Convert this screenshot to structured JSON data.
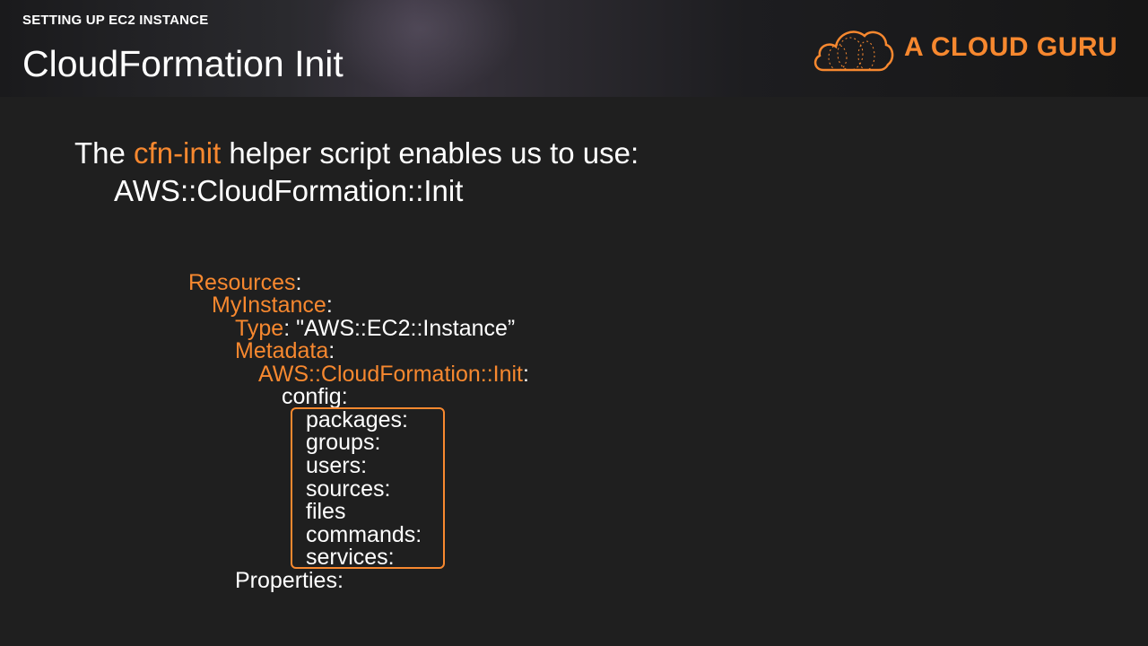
{
  "header": {
    "kicker": "SETTING UP EC2 INSTANCE",
    "title": "CloudFormation Init",
    "logo_text": "A CLOUD GURU",
    "logo_icon": "cloud-icon",
    "accent_color": "#f7882f"
  },
  "intro": {
    "prefix": "The ",
    "highlight": "cfn-init",
    "suffix": " helper script enables us to use:",
    "line2": "AWS::CloudFormation::Init"
  },
  "code": {
    "resources_key": "Resources",
    "myinstance_key": "MyInstance",
    "type_key": "Type",
    "type_value": ": \"AWS::EC2::Instance”",
    "metadata_key": "Metadata",
    "init_key": "AWS::CloudFormation::Init",
    "colon": ":",
    "config": "config:",
    "config_items": [
      "packages:",
      "groups:",
      "users:",
      "sources:",
      "files",
      "commands:",
      "services:"
    ],
    "properties": "Properties:"
  }
}
